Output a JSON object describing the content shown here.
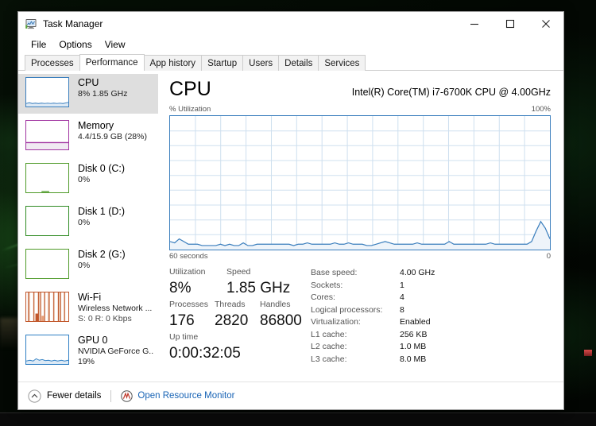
{
  "window": {
    "title": "Task Manager",
    "icon": "task-manager-icon",
    "minimize_label": "Minimize",
    "maximize_label": "Maximize",
    "close_label": "Close"
  },
  "menu": [
    "File",
    "Options",
    "View"
  ],
  "tabs": [
    {
      "label": "Processes",
      "active": false
    },
    {
      "label": "Performance",
      "active": true
    },
    {
      "label": "App history",
      "active": false
    },
    {
      "label": "Startup",
      "active": false
    },
    {
      "label": "Users",
      "active": false
    },
    {
      "label": "Details",
      "active": false
    },
    {
      "label": "Services",
      "active": false
    }
  ],
  "sidebar": {
    "items": [
      {
        "name": "cpu",
        "title": "CPU",
        "sub1": "8%  1.85 GHz",
        "sub2": "",
        "color": "#3a7ebd",
        "selected": true
      },
      {
        "name": "memory",
        "title": "Memory",
        "sub1": "4.4/15.9 GB (28%)",
        "sub2": "",
        "color": "#a033a0",
        "selected": false
      },
      {
        "name": "disk0",
        "title": "Disk 0 (C:)",
        "sub1": "0%",
        "sub2": "",
        "color": "#4e9a28",
        "selected": false
      },
      {
        "name": "disk1",
        "title": "Disk 1 (D:)",
        "sub1": "0%",
        "sub2": "",
        "color": "#2f8b23",
        "selected": false
      },
      {
        "name": "disk2",
        "title": "Disk 2 (G:)",
        "sub1": "0%",
        "sub2": "",
        "color": "#4e9a28",
        "selected": false
      },
      {
        "name": "wifi",
        "title": "Wi-Fi",
        "sub1": "Wireless Network ...",
        "sub2": "S: 0 R: 0 Kbps",
        "color": "#c1562a",
        "selected": false
      },
      {
        "name": "gpu0",
        "title": "GPU 0",
        "sub1": "NVIDIA GeForce G...",
        "sub2": "19%",
        "color": "#2f7fc4",
        "selected": false
      }
    ]
  },
  "main": {
    "title": "CPU",
    "model": "Intel(R) Core(TM) i7-6700K CPU @ 4.00GHz",
    "chart_top_left_label": "% Utilization",
    "chart_top_right_label": "100%",
    "chart_bottom_left_label": "60 seconds",
    "chart_bottom_right_label": "0",
    "stats_left": [
      [
        {
          "label": "Utilization",
          "value": "8%"
        },
        {
          "label": "Speed",
          "value": "1.85 GHz"
        }
      ],
      [
        {
          "label": "Processes",
          "value": "176"
        },
        {
          "label": "Threads",
          "value": "2820"
        },
        {
          "label": "Handles",
          "value": "86800"
        }
      ],
      [
        {
          "label": "Up time",
          "value": "0:00:32:05"
        }
      ]
    ],
    "stats_right": [
      {
        "label": "Base speed:",
        "value": "4.00 GHz"
      },
      {
        "label": "Sockets:",
        "value": "1"
      },
      {
        "label": "Cores:",
        "value": "4"
      },
      {
        "label": "Logical processors:",
        "value": "8"
      },
      {
        "label": "Virtualization:",
        "value": "Enabled"
      },
      {
        "label": "L1 cache:",
        "value": "256 KB"
      },
      {
        "label": "L2 cache:",
        "value": "1.0 MB"
      },
      {
        "label": "L3 cache:",
        "value": "8.0 MB"
      }
    ]
  },
  "footer": {
    "fewer_details": "Fewer details",
    "open_resource_monitor": "Open Resource Monitor"
  },
  "colors": {
    "cpu_line": "#3a7ebd",
    "cpu_fill": "#eef4fa",
    "grid": "#cfe0ef",
    "link": "#1763b5",
    "selection": "#dedede"
  },
  "chart_data": {
    "type": "area",
    "title": "CPU % Utilization over 60 seconds",
    "xlabel": "60 seconds",
    "ylabel": "% Utilization",
    "xlim": [
      60,
      0
    ],
    "ylim": [
      0,
      100
    ],
    "grid": true,
    "legend": null,
    "series": [
      {
        "name": "CPU Utilization",
        "color": "#3a7ebd",
        "values": [
          6,
          5,
          8,
          6,
          4,
          4,
          4,
          3,
          3,
          3,
          3,
          4,
          3,
          4,
          3,
          3,
          5,
          3,
          3,
          4,
          4,
          4,
          4,
          4,
          4,
          4,
          4,
          3,
          4,
          4,
          5,
          4,
          4,
          4,
          4,
          4,
          5,
          4,
          4,
          5,
          4,
          4,
          4,
          3,
          3,
          4,
          5,
          6,
          5,
          4,
          4,
          4,
          4,
          4,
          5,
          4,
          4,
          4,
          4,
          4,
          4,
          6,
          4,
          4,
          4,
          4,
          4,
          4,
          4,
          4,
          5,
          4,
          4,
          4,
          4,
          4,
          4,
          4,
          4,
          6,
          14,
          21,
          16,
          8
        ]
      }
    ]
  }
}
